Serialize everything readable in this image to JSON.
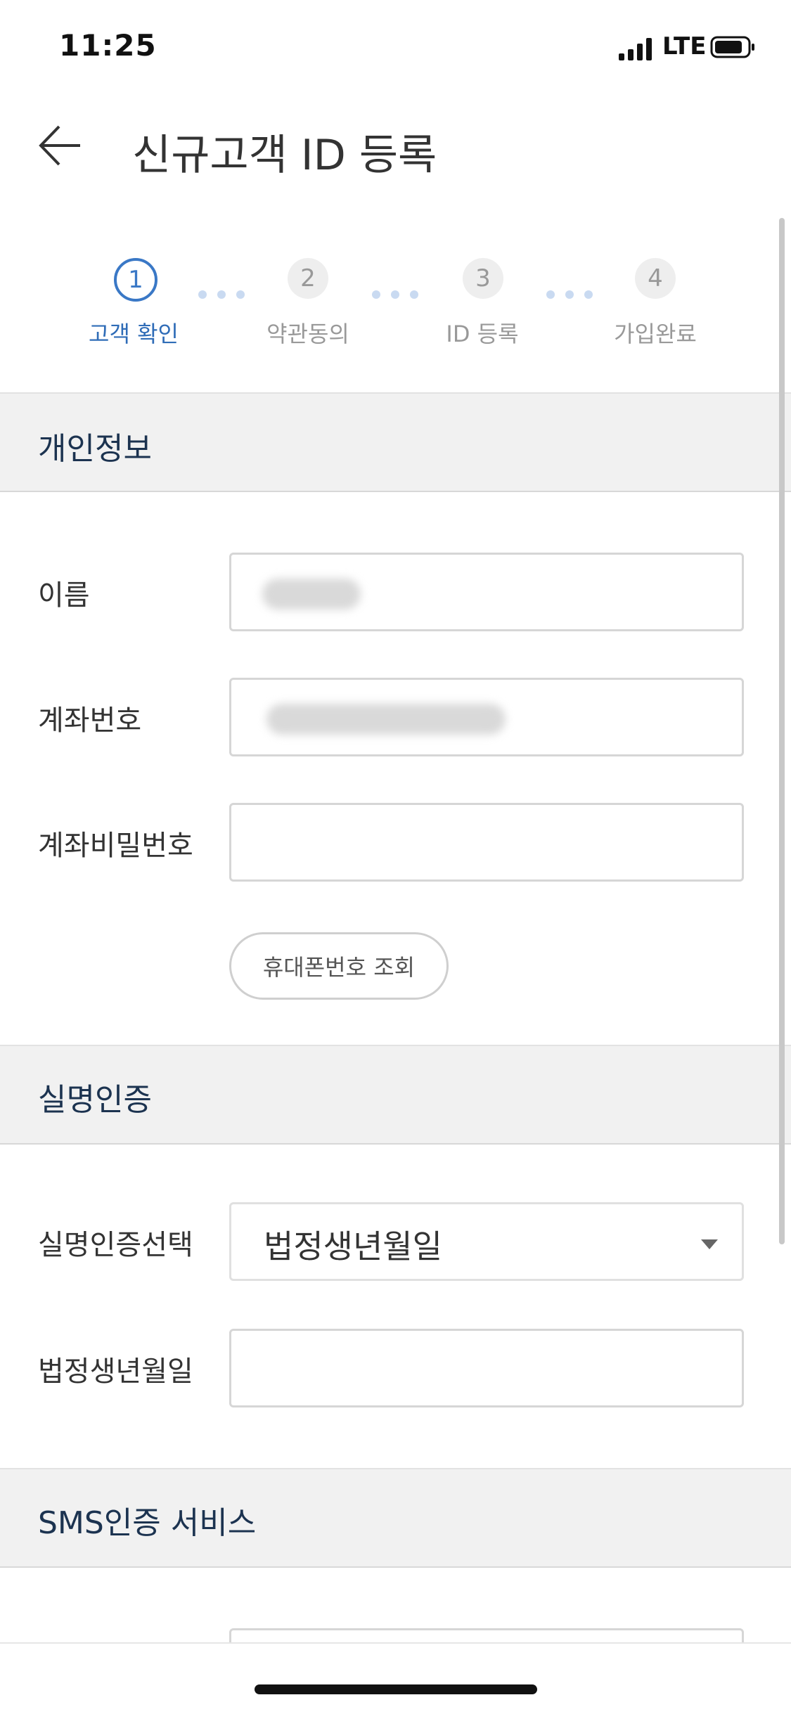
{
  "status_bar": {
    "time": "11:25",
    "network": "LTE"
  },
  "header": {
    "title": "신규고객 ID 등록"
  },
  "steps": [
    {
      "number": "1",
      "label": "고객 확인"
    },
    {
      "number": "2",
      "label": "약관동의"
    },
    {
      "number": "3",
      "label": "ID 등록"
    },
    {
      "number": "4",
      "label": "가입완료"
    }
  ],
  "section_personal": {
    "title": "개인정보",
    "name_label": "이름",
    "account_label": "계좌번호",
    "account_pw_label": "계좌비밀번호",
    "phone_lookup_button": "휴대폰번호 조회"
  },
  "section_realname": {
    "title": "실명인증",
    "select_label": "실명인증선택",
    "select_value": "법정생년월일",
    "birth_label": "법정생년월일"
  },
  "section_sms": {
    "title": "SMS인증 서비스"
  },
  "colors": {
    "accent": "#3a78c6",
    "section_bg": "#f1f1f1",
    "section_title": "#1c3350"
  }
}
